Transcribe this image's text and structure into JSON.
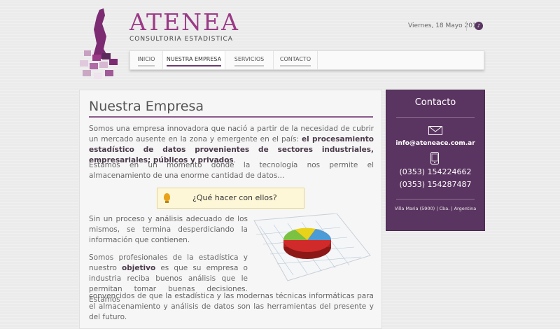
{
  "brand": {
    "name": "ATENEA",
    "tagline": "CONSULTORIA ESTADISTICA"
  },
  "header": {
    "date": "Viernes, 18 Mayo 2012",
    "social_icon": "microphone-icon"
  },
  "nav": {
    "items": [
      {
        "label": "INICIO"
      },
      {
        "label": "NUESTRA EMPRESA",
        "active": true
      },
      {
        "label": "SERVICIOS"
      },
      {
        "label": "CONTACTO"
      }
    ]
  },
  "main": {
    "title": "Nuestra Empresa",
    "p1_text": "Somos una empresa innovadora que nació a partir de la necesidad de cubrir un mercado ausente en la zona y emergente en el país: ",
    "p1_bold": "el procesamiento estadístico de datos provenientes de sectores industriales, empresariales; públicos y privados",
    "p1_end": ".",
    "p2": "Estamos en un momento dónde la tecnología nos permite el almacenamiento de una enorme cantidad de datos...",
    "callout": "¿Qué hacer con ellos?",
    "p3": "Sin un proceso y análisis adecuado de los mismos, se termina desperdiciando la información que contienen.",
    "p4_start": "Somos profesionales de la estadística y nuestro ",
    "p4_bold": "objetivo",
    "p4_end": " es que su empresa o industria reciba buenos análisis que le permitan tomar buenas decisiones. Estamos",
    "p5": "convencidos de que la estadística y las modernas técnicas informáticas para el almacenamiento y análisis de datos son las herramientas del presente y del futuro."
  },
  "contact": {
    "title": "Contacto",
    "email": "info@ateneace.com.ar",
    "phone_1": "(0353) 154224662",
    "phone_2": "(0353) 154287487",
    "address": "Villa Maria (5900) | Cba. | Argentina"
  },
  "colors": {
    "brand": "#9b3a86",
    "panel": "#5b3561",
    "callout_bg": "#fdf7d8"
  }
}
